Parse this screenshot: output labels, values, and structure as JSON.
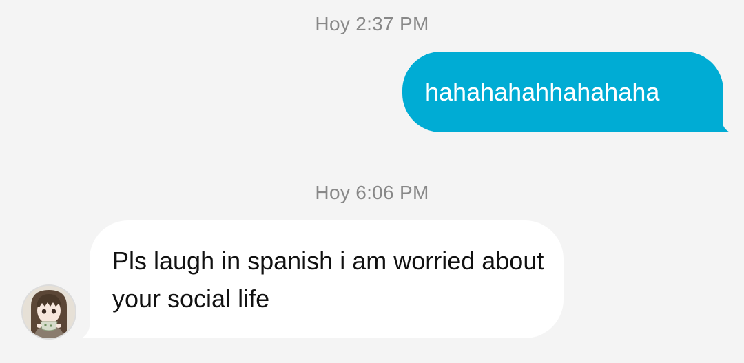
{
  "conversation": {
    "messages": [
      {
        "timestamp": "Hoy 2:37 PM",
        "direction": "outgoing",
        "text": "hahahahahhahahaha"
      },
      {
        "timestamp": "Hoy 6:06 PM",
        "direction": "incoming",
        "text": "Pls laugh in spanish i am worried about your social life"
      }
    ]
  },
  "colors": {
    "background": "#f4f4f4",
    "outgoing_bubble": "#00acd4",
    "incoming_bubble": "#ffffff",
    "timestamp_text": "#888888"
  },
  "contact": {
    "avatar_icon": "avatar-anime-girl-icon"
  }
}
